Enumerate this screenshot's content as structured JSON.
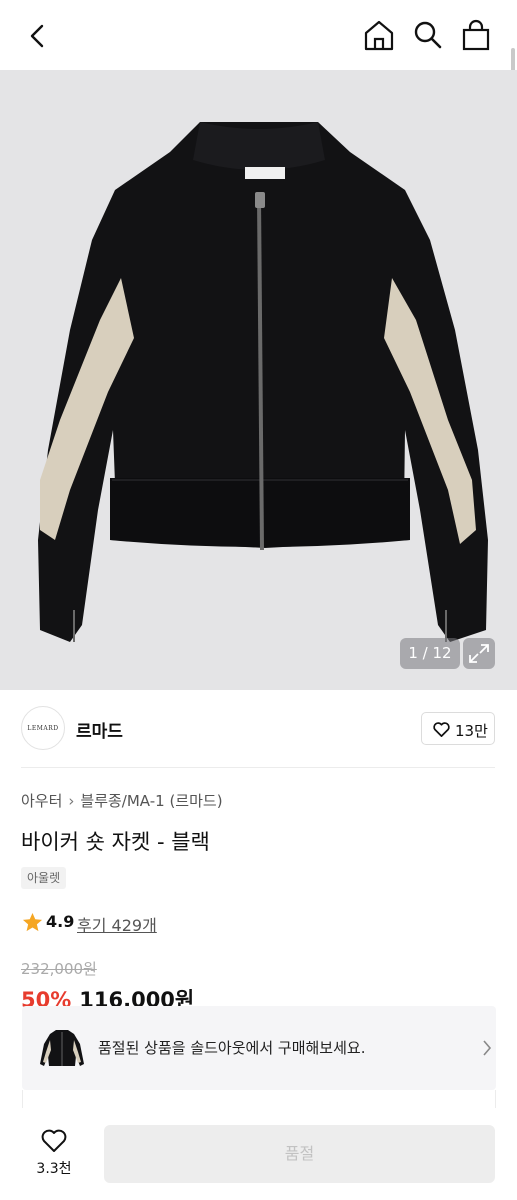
{
  "header": {
    "back_icon": "chevron-left-icon",
    "home_icon": "home-icon",
    "search_icon": "search-icon",
    "cart_icon": "shopping-bag-icon"
  },
  "gallery": {
    "counter": "1 / 12",
    "expand_icon": "expand-icon",
    "background_color": "#e4e4e6"
  },
  "brand": {
    "logo_text": "LEMARD",
    "name": "르마드",
    "like_count": "13만"
  },
  "product": {
    "breadcrumb": [
      "아우터",
      "블루종/MA-1 (르마드)"
    ],
    "title": "바이커 숏 자켓 - 블랙",
    "tag": "아울렛",
    "rating": "4.9",
    "reviews": "후기 429개",
    "original_price": "232,000원",
    "discount": "50%",
    "sale_price": "116,000원"
  },
  "soldout_banner": {
    "text": "품절된 상품을 솔드아웃에서 구매해보세요."
  },
  "bottom_bar": {
    "wish_count": "3.3천",
    "button_label": "품절"
  },
  "colors": {
    "discount_red": "#e73c2e",
    "star": "#f5a623"
  }
}
